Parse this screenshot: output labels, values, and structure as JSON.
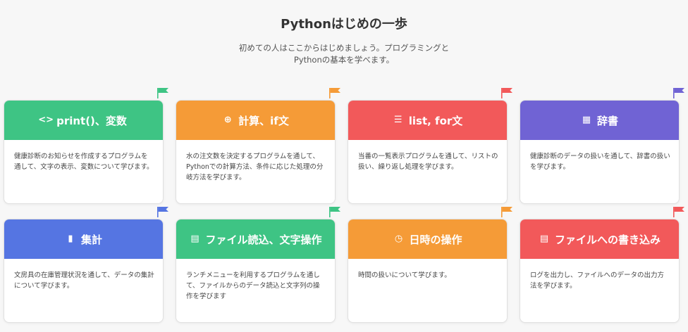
{
  "header": {
    "title": "Pythonはじめの一歩",
    "subtitle_line1": "初めての人はここからはじめましょう。プログラミングと",
    "subtitle_line2": "Pythonの基本を学べます。"
  },
  "cards": [
    {
      "title": "print()、変数",
      "icon": "code-icon",
      "glyph": "<>",
      "color": "#3ec484",
      "desc": "健康診断のお知らせを作成するプログラムを通して、文字の表示、変数について学びます。"
    },
    {
      "title": "計算、if文",
      "icon": "plus-circle-icon",
      "glyph": "⊕",
      "color": "#f59b37",
      "desc": "水の注文数を決定するプログラムを通して、Pythonでの計算方法、条件に応じた処理の分岐方法を学びます。"
    },
    {
      "title": "list, for文",
      "icon": "list-icon",
      "glyph": "☰",
      "color": "#f2595a",
      "desc": "当番の一覧表示プログラムを通して、リストの扱い、繰り返し処理を学びます。"
    },
    {
      "title": "辞書",
      "icon": "dictionary-icon",
      "glyph": "▦",
      "color": "#7063d4",
      "desc": "健康診断のデータの扱いを通して、辞書の扱いを学びます。"
    },
    {
      "title": "集計",
      "icon": "book-icon",
      "glyph": "▮",
      "color": "#5575e2",
      "desc": "文房具の在庫管理状況を通して、データの集計について学びます。"
    },
    {
      "title": "ファイル読込、文字操作",
      "icon": "file-icon",
      "glyph": "▤",
      "color": "#3ec484",
      "desc": "ランチメニューを利用するプログラムを通して、ファイルからのデータ読込と文字列の操作を学びます"
    },
    {
      "title": "日時の操作",
      "icon": "clock-icon",
      "glyph": "◷",
      "color": "#f59b37",
      "desc": "時間の扱いについて学びます。"
    },
    {
      "title": "ファイルへの書き込み",
      "icon": "file-icon",
      "glyph": "▤",
      "color": "#f2595a",
      "desc": "ログを出力し、ファイルへのデータの出力方法を学びます。"
    }
  ],
  "flags": [
    {
      "icon": "flag-icon",
      "color": "#3ec484"
    },
    {
      "icon": "flag-icon",
      "color": "#f59b37"
    },
    {
      "icon": "flag-icon",
      "color": "#f2595a"
    },
    {
      "icon": "flag-icon",
      "color": "#7063d4"
    },
    {
      "icon": "flag-icon",
      "color": "#5575e2"
    },
    {
      "icon": "flag-icon",
      "color": "#3ec484"
    },
    {
      "icon": "flag-icon",
      "color": "#f59b37"
    },
    {
      "icon": "flag-icon",
      "color": "#f2595a"
    }
  ]
}
